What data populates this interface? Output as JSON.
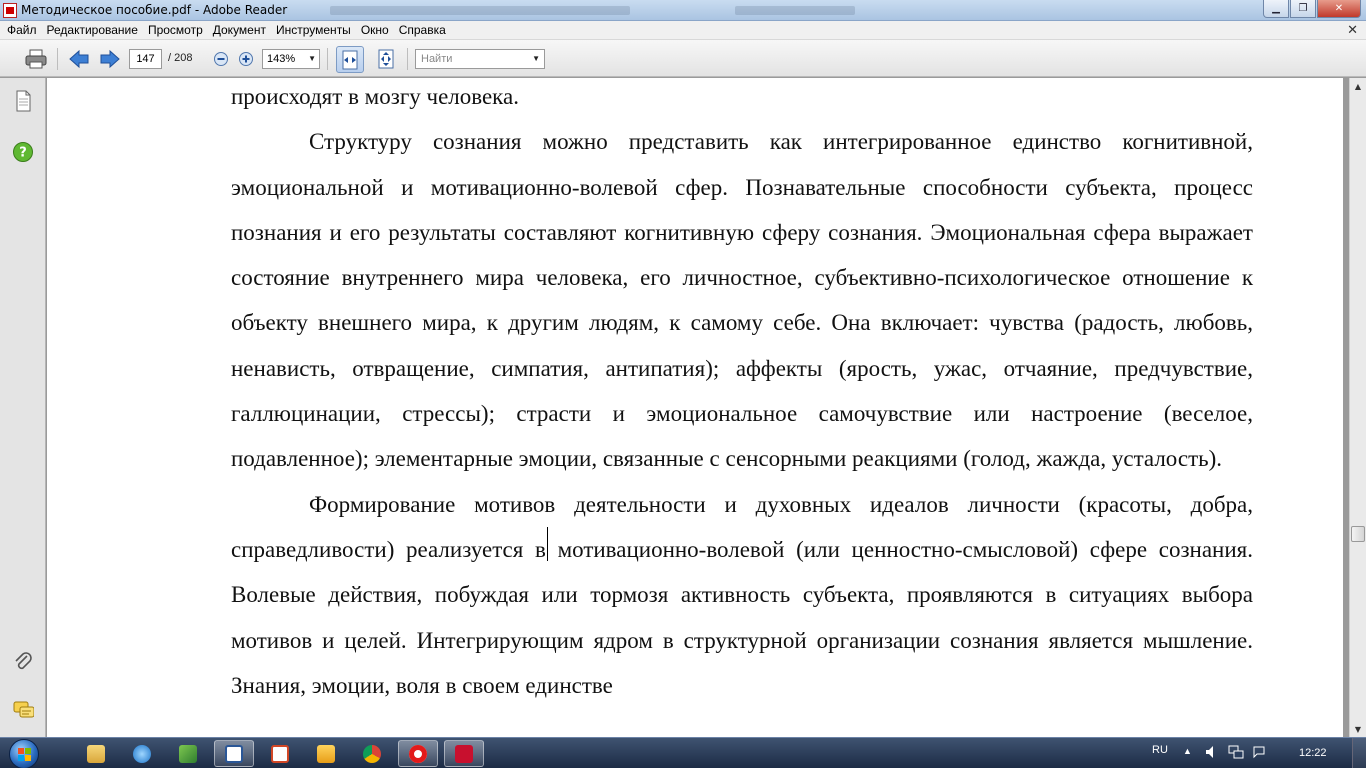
{
  "window": {
    "title": "Методическое пособие.pdf - Adobe Reader"
  },
  "menu": {
    "items": [
      "Файл",
      "Редактирование",
      "Просмотр",
      "Документ",
      "Инструменты",
      "Окно",
      "Справка"
    ],
    "close_glyph": "✕"
  },
  "toolbar": {
    "current_page": "147",
    "total_pages": "/  208",
    "zoom": "143%",
    "find_placeholder": "Найти"
  },
  "document": {
    "paragraphs": [
      "происходят в мозгу человека.",
      "Структуру сознания можно представить как интегрированное единство когнитивной, эмоциональной и мотивационно-волевой сфер. Познавательные способности субъекта, процесс познания и его результаты составляют когнитивную сферу сознания. Эмоциональная сфера выражает состояние внутреннего мира человека, его личностное, субъективно-психологическое отношение к объекту внешнего мира, к другим людям, к самому себе. Она включает: чувства (радость, любовь, ненависть, отвращение, симпатия, антипатия); аффекты (ярость, ужас, отчаяние, предчувствие, галлюцинации, стрессы); страсти и эмоциональное самочувствие или настроение (веселое, подавленное); элементарные эмоции, связанные с сенсорными реакциями (голод, жажда, усталость).",
      "Формирование мотивов деятельности и духовных идеалов личности (красоты, добра, справедливости) реализуется в мотивационно-волевой (или ценностно-смысловой) сфере сознания. Волевые действия, побуждая или тормозя активность субъекта, проявляются в ситуациях выбора мотивов и целей. Интегрирующим ядром в структурной организации сознания является мышление. Знания, эмоции, воля в своем единстве"
    ]
  },
  "taskbar": {
    "language": "RU",
    "clock": "12:22",
    "apps": [
      "explorer",
      "internet-explorer",
      "file-manager",
      "word",
      "presentation",
      "media-player",
      "chrome",
      "opera",
      "adobe-reader"
    ]
  },
  "colors": {
    "accent_red": "#c8102e",
    "toolbar_active": "#b8cfee"
  }
}
